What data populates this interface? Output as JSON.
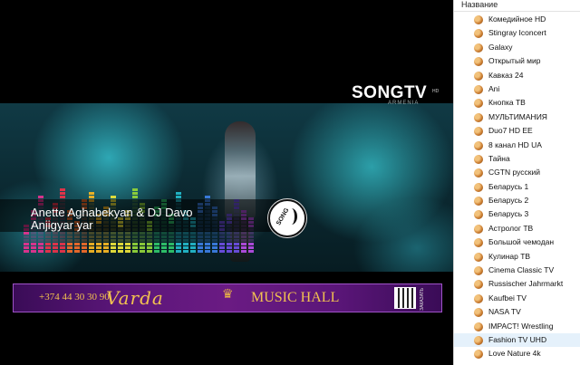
{
  "player": {
    "logo": {
      "main": "SONGTV",
      "hd": "HD",
      "sub": "ARMENIA"
    },
    "now_playing": {
      "artist": "Anette Aghabekyan & DJ Davo",
      "track": "Anjigyar yar"
    },
    "badge_text": "SONG",
    "banner": {
      "phone": "+374 44 30 30 90",
      "brand": "Varda",
      "title": "MUSIC HALL",
      "tag": "ЗАКАЗАТЬ"
    }
  },
  "channel_list": {
    "header": "Название",
    "selected_index": 23,
    "items": [
      "Комедийное HD",
      "Stingray Iconcert",
      "Galaxy",
      "Открытый мир",
      "Кавказ 24",
      "Ani",
      "Кнопка ТВ",
      "МУЛЬТИМАНИЯ",
      "Duo7 HD EE",
      "8 канал HD UA",
      "Тайна",
      "CGTN русский",
      "Беларусь 1",
      "Беларусь 2",
      "Беларусь 3",
      "Астролог ТВ",
      "Большой чемодан",
      "Кулинар ТВ",
      "Cinema Classic TV",
      "Russischer Jahrmarkt",
      "Kaufbei TV",
      "NASA TV",
      "IMPACT! Wrestling",
      "Fashion TV UHD",
      "Love Nature 4k"
    ]
  },
  "colors": {
    "list_selected": "#e5f1fb",
    "logo_accent": "#e8324e",
    "banner_gold": "#f2c250"
  }
}
